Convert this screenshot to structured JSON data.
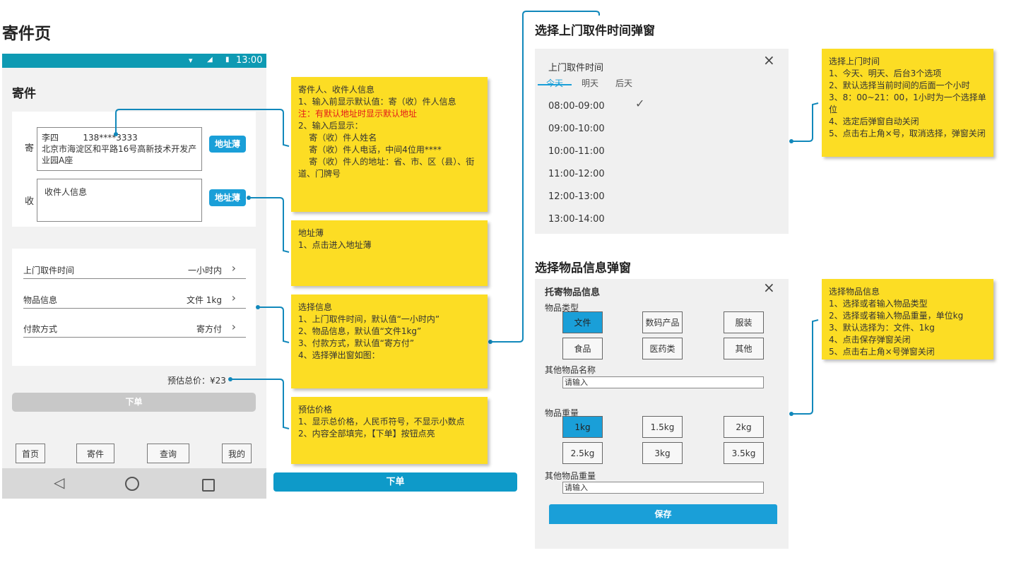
{
  "page_title": "寄件页",
  "status_bar": {
    "time": "13:00"
  },
  "phone": {
    "header_title": "寄件",
    "sender": {
      "tag": "寄",
      "name_phone": "李四         138****3333",
      "address": "北京市海淀区和平路16号高新技术开发产业园A座",
      "book_button": "地址薄"
    },
    "receiver": {
      "tag": "收",
      "placeholder": "收件人信息",
      "book_button": "地址薄"
    },
    "rows": [
      {
        "label": "上门取件时间",
        "value": "一小时内"
      },
      {
        "label": "物品信息",
        "value": "文件 1kg"
      },
      {
        "label": "付款方式",
        "value": "寄方付"
      }
    ],
    "total_label": "预估总价：¥23",
    "submit_label": "下单",
    "tabs": [
      "首页",
      "寄件",
      "查询",
      "我的"
    ]
  },
  "notes": {
    "contact": {
      "title": "寄件人、收件人信息",
      "line1": "1、输入前显示默认值：寄（收）件人信息",
      "red": "注：有默认地址时显示默认地址",
      "line2": "2、输入后显示：",
      "line3": "    寄（收）件人姓名",
      "line4": "    寄（收）件人电话，中间4位用****",
      "line5": "    寄（收）件人的地址：省、市、区（县）、街道、门牌号"
    },
    "address_book": {
      "title": "地址薄",
      "line1": "1、点击进入地址薄"
    },
    "select_info": {
      "title": "选择信息",
      "line1": "1、上门取件时间，默认值“一小时内”",
      "line2": "2、物品信息，默认值“文件1kg”",
      "line3": "3、付款方式，默认值“寄方付”",
      "line4": "4、选择弹出窗如图："
    },
    "price": {
      "title": "预估价格",
      "line1": "1、显示总价格，人民币符号，不显示小数点",
      "line2": "2、内容全部填完，【下单】按钮点亮"
    },
    "time_popup": {
      "title": "选择上门时间",
      "line1": "1、今天、明天、后台3个选项",
      "line2": "2、默认选择当前时间的后面一个小时",
      "line3": "3、8：00~21：00，1小时为一个选择单位",
      "line4": "4、选定后弹窗自动关闭",
      "line5": "5、点击右上角×号，取消选择，弹窗关闭"
    },
    "item_popup": {
      "title": "选择物品信息",
      "line1": "1、选择或者输入物品类型",
      "line2": "2、选择或者输入物品重量，单位kg",
      "line3": "3、默认选择为：文件、1kg",
      "line4": "4、点击保存弹窗关闭",
      "line5": "5、点击右上角×号弹窗关闭"
    }
  },
  "big_submit_label": "下单",
  "time_popup": {
    "section_title": "选择上门取件时间弹窗",
    "title": "上门取件时间",
    "tabs": [
      "今天",
      "明天",
      "后天"
    ],
    "slots": [
      "08:00-09:00",
      "09:00-10:00",
      "10:00-11:00",
      "11:00-12:00",
      "12:00-13:00",
      "13:00-14:00"
    ]
  },
  "item_popup": {
    "section_title": "选择物品信息弹窗",
    "title": "托寄物品信息",
    "type_label": "物品类型",
    "types": [
      "文件",
      "数码产品",
      "服装",
      "食品",
      "医药类",
      "其他"
    ],
    "other_name_label": "其他物品名称",
    "other_name_placeholder": "请输入",
    "weight_label": "物品重量",
    "weights": [
      "1kg",
      "1.5kg",
      "2kg",
      "2.5kg",
      "3kg",
      "3.5kg"
    ],
    "other_weight_label": "其他物品重量",
    "other_weight_placeholder": "请输入",
    "save_label": "保存"
  },
  "colors": {
    "accent": "#1a9fd8",
    "status_bar": "#0e9ab3",
    "note": "#fcdd24",
    "connector": "#1188bb"
  }
}
